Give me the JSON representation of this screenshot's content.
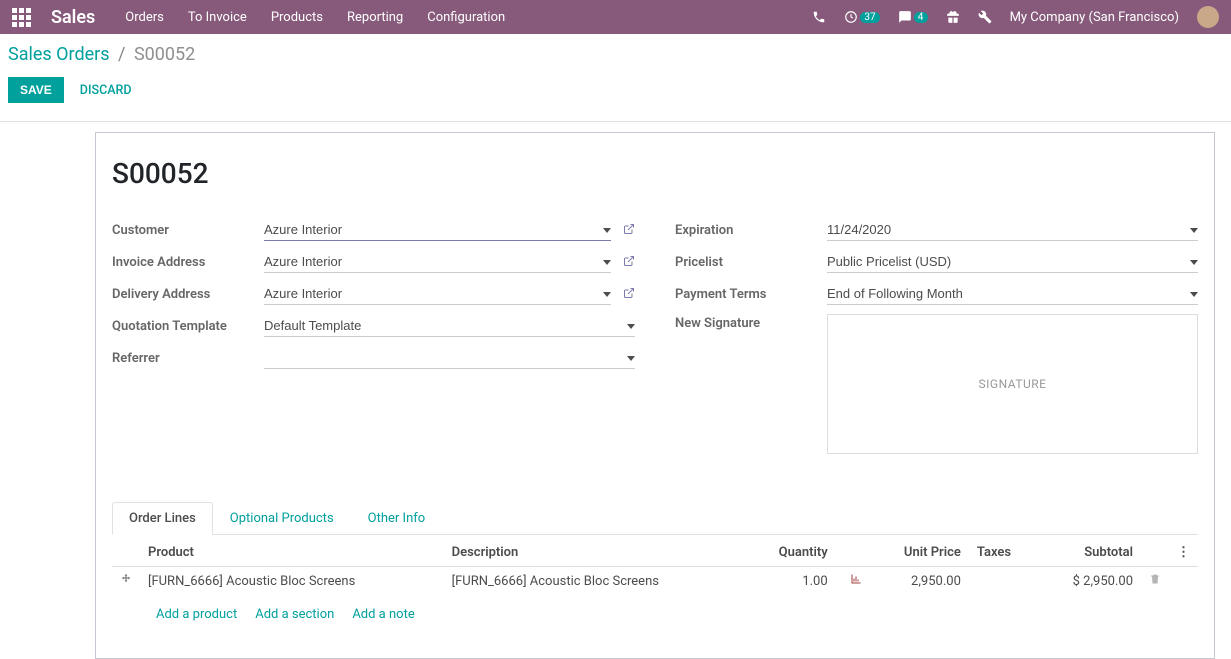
{
  "navbar": {
    "brand": "Sales",
    "menu": [
      "Orders",
      "To Invoice",
      "Products",
      "Reporting",
      "Configuration"
    ],
    "activities_badge": "37",
    "messages_badge": "4",
    "company": "My Company (San Francisco)"
  },
  "breadcrumb": {
    "root": "Sales Orders",
    "sep": "/",
    "current": "S00052"
  },
  "buttons": {
    "save": "SAVE",
    "discard": "DISCARD"
  },
  "record": {
    "name": "S00052"
  },
  "fields": {
    "customer": {
      "label": "Customer",
      "value": "Azure Interior"
    },
    "invoice_address": {
      "label": "Invoice Address",
      "value": "Azure Interior"
    },
    "delivery_address": {
      "label": "Delivery Address",
      "value": "Azure Interior"
    },
    "quotation_template": {
      "label": "Quotation Template",
      "value": "Default Template"
    },
    "referrer": {
      "label": "Referrer",
      "value": ""
    },
    "expiration": {
      "label": "Expiration",
      "value": "11/24/2020"
    },
    "pricelist": {
      "label": "Pricelist",
      "value": "Public Pricelist (USD)"
    },
    "payment_terms": {
      "label": "Payment Terms",
      "value": "End of Following Month"
    },
    "signature": {
      "label": "New Signature",
      "placeholder": "SIGNATURE"
    }
  },
  "tabs": [
    "Order Lines",
    "Optional Products",
    "Other Info"
  ],
  "table": {
    "headers": {
      "product": "Product",
      "description": "Description",
      "quantity": "Quantity",
      "unit_price": "Unit Price",
      "taxes": "Taxes",
      "subtotal": "Subtotal"
    },
    "rows": [
      {
        "product": "[FURN_6666] Acoustic Bloc Screens",
        "description": "[FURN_6666] Acoustic Bloc Screens",
        "quantity": "1.00",
        "unit_price": "2,950.00",
        "taxes": "",
        "subtotal": "$ 2,950.00"
      }
    ],
    "add_product": "Add a product",
    "add_section": "Add a section",
    "add_note": "Add a note"
  }
}
